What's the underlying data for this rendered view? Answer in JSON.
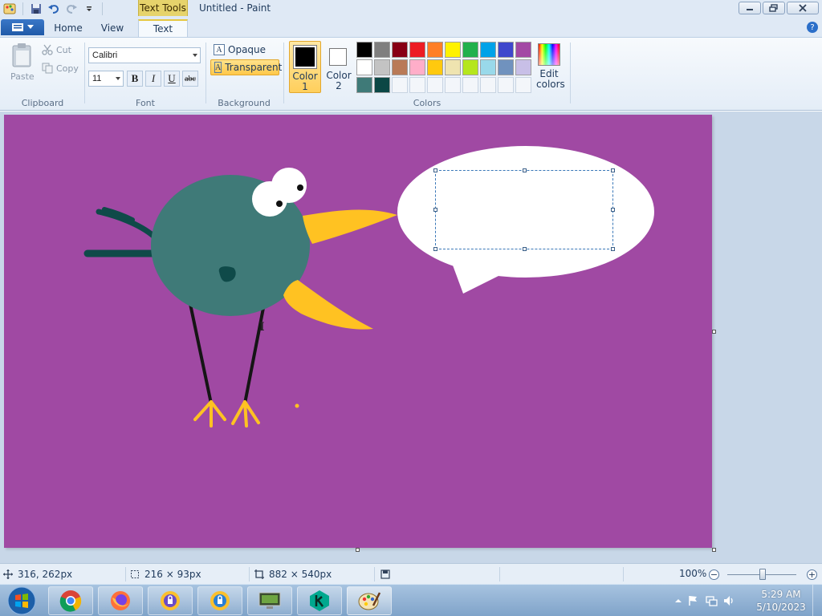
{
  "window": {
    "title": "Untitled - Paint",
    "context_tab": "Text Tools"
  },
  "ribbon_tabs": {
    "home": "Home",
    "view": "View",
    "text": "Text"
  },
  "clipboard": {
    "paste": "Paste",
    "cut": "Cut",
    "copy": "Copy",
    "label": "Clipboard"
  },
  "font": {
    "family": "Calibri",
    "size": "11",
    "bold": "B",
    "italic": "I",
    "underline": "U",
    "strike": "abc",
    "label": "Font"
  },
  "background": {
    "opaque": "Opaque",
    "transparent": "Transparent",
    "label": "Background"
  },
  "colors": {
    "color1_label_a": "Color",
    "color1_label_b": "1",
    "color2_label_a": "Color",
    "color2_label_b": "2",
    "color1_value": "#000000",
    "color2_value": "#ffffff",
    "edit_label_a": "Edit",
    "edit_label_b": "colors",
    "label": "Colors",
    "palette": [
      "#000000",
      "#7f7f7f",
      "#880015",
      "#ed1c24",
      "#ff7f27",
      "#fff200",
      "#22b14c",
      "#00a2e8",
      "#3f48cc",
      "#a349a4",
      "#ffffff",
      "#c3c3c3",
      "#b97a57",
      "#ffaec9",
      "#ffc90e",
      "#efe4b0",
      "#b5e61d",
      "#99d9ea",
      "#7092be",
      "#c8bfe7",
      "#3f7a78",
      "#0b4745",
      "",
      "",
      "",
      "",
      "",
      "",
      "",
      ""
    ]
  },
  "canvas": {
    "background_color": "#a049a3"
  },
  "status": {
    "cursor_pos": "316, 262px",
    "selection_size": "216 × 93px",
    "canvas_size": "882 × 540px",
    "zoom": "100%",
    "zoom_minus": "−",
    "zoom_plus": "+"
  },
  "taskbar": {
    "apps": [
      "chrome-icon",
      "firefox-icon",
      "vpn-shield-icon",
      "vpn-shield-icon-2",
      "remote-desktop-icon",
      "kaspersky-icon",
      "paint-icon"
    ],
    "time": "5:29 AM",
    "date": "5/10/2023"
  }
}
